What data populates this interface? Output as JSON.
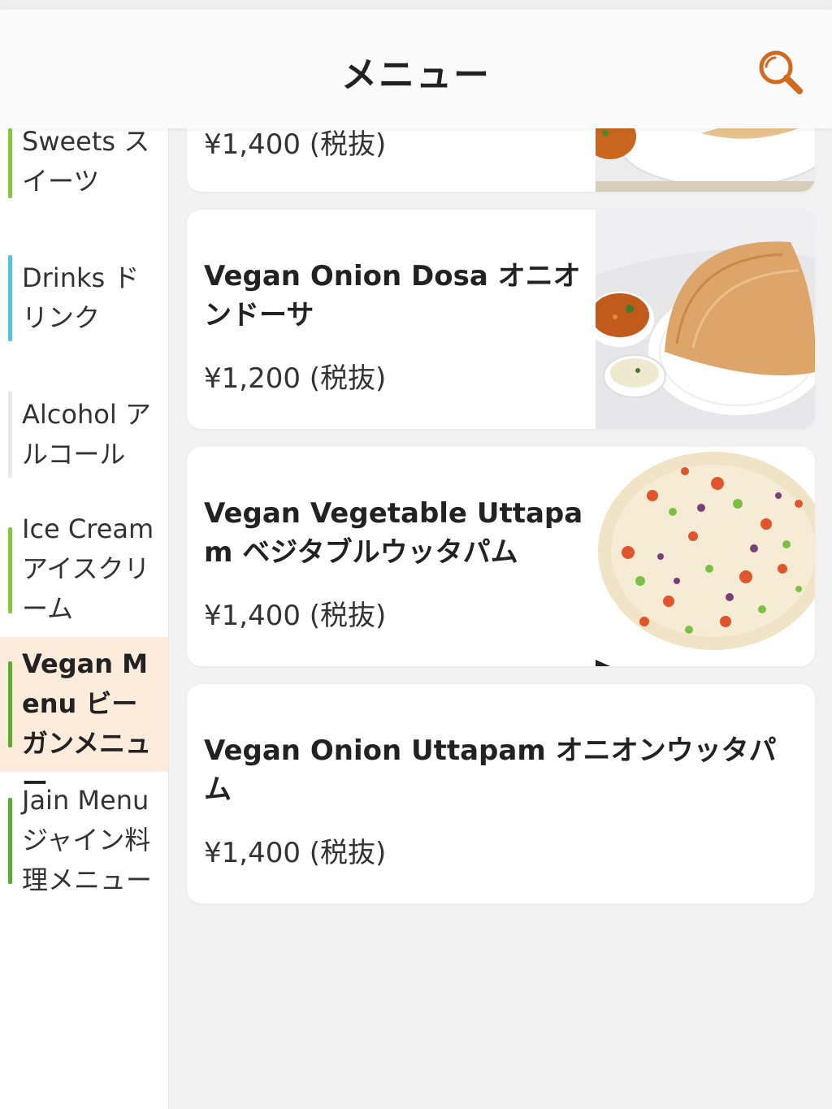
{
  "header": {
    "title": "メニュー",
    "search_icon": "search-icon"
  },
  "colors": {
    "accent": "#d2691e",
    "active_bg": "#fdebdc"
  },
  "sidebar": {
    "items": [
      {
        "label": "Sweets スイーツ",
        "bar_color": "#8bc34a",
        "active": false
      },
      {
        "label": "Drinks ドリンク",
        "bar_color": "#5bc0de",
        "active": false
      },
      {
        "label": "Alcohol アルコール",
        "bar_color": "#e8e8e8",
        "active": false
      },
      {
        "label": "Ice Cream アイスクリーム",
        "bar_color": "#8bc34a",
        "active": false
      },
      {
        "label": "Vegan Menu ビーガンメニュー",
        "bar_color": "#5fa83a",
        "active": true
      },
      {
        "label": "Jain Menu ジャイン料理メニュー",
        "bar_color": "#5fa83a",
        "active": false
      }
    ]
  },
  "menu": {
    "items": [
      {
        "name": "",
        "price": "¥1,400 (税抜)",
        "image": "dosa-plate-photo"
      },
      {
        "name": "Vegan Onion Dosa オニオンドーサ",
        "price": "¥1,200 (税抜)",
        "image": "onion-dosa-photo"
      },
      {
        "name": "Vegan Vegetable Uttapam ベジタブルウッタパム",
        "price": "¥1,400 (税抜)",
        "image": "vegetable-uttapam-photo"
      },
      {
        "name": "Vegan Onion Uttapam オニオンウッタパム",
        "price": "¥1,400 (税抜)",
        "image": ""
      }
    ]
  }
}
